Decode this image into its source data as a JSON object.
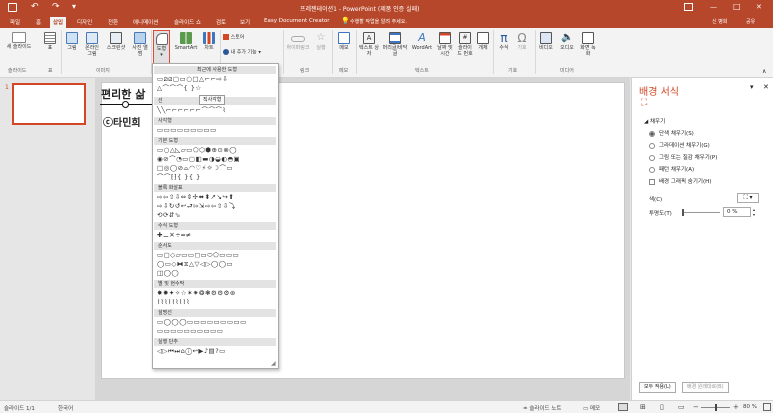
{
  "titlebar": {
    "doc_title": "프레젠테이션1 - PowerPoint (제품 인증 실패)",
    "user": "신 병희",
    "minimize": "—",
    "maximize": "□",
    "close": "✕"
  },
  "tabs": [
    "파일",
    "홈",
    "삽입",
    "디자인",
    "전환",
    "애니메이션",
    "슬라이드 쇼",
    "검토",
    "보기",
    "Easy Document Creator"
  ],
  "active_tab": "삽입",
  "tell_me": "수행할 작업을 알려 주세요.",
  "share": "공유",
  "ribbon": {
    "new_slide": "새 슬라이드",
    "table": "표",
    "picture": "그림",
    "online_picture": "온라인 그림",
    "screenshot": "스크린샷",
    "photo_album": "사진 앨범",
    "shapes": "도형",
    "smartart": "SmartArt",
    "chart": "차트",
    "store": "스토어",
    "my_addins": "내 추가 기능",
    "hyperlink": "하이퍼링크",
    "action": "실행",
    "comment": "메모",
    "textbox": "텍스트 상자",
    "header_footer": "머리글/바닥글",
    "wordart": "WordArt",
    "date_time": "날짜 및 시간",
    "slide_number": "슬라이드 번호",
    "object": "개체",
    "equation": "수식",
    "symbol": "기호",
    "video": "비디오",
    "audio": "오디오",
    "screen_recording": "화면 녹화",
    "groups": {
      "slides": "슬라이드",
      "tables": "표",
      "images": "이미지",
      "links": "링크",
      "comments": "메모",
      "text": "텍스트",
      "symbols": "기호",
      "media": "미디어"
    }
  },
  "gallery": {
    "recent": "최근에 사용한 도형",
    "lines": "선",
    "rectangles": "사각형",
    "basic": "기본 도형",
    "block_arrows": "블록 화살표",
    "equation": "수식 도형",
    "flowchart": "순서도",
    "stars": "별 및 현수막",
    "callouts": "설명선",
    "action_buttons": "실행 단추",
    "tooltip": "직사각형",
    "rows": {
      "recent": "▭⧄⧄▢▭○□△⌐⌐⇨⇩",
      "recent2": "△⌒⌒⌒{ }☆",
      "lines": "╲╲⌐⌐⌐⌐⌐⌐⌒⌒⌒⌇",
      "rectangles": "▭▭▭▭▭▭▭▭▭",
      "basic1": "▭○△◺▱▭⬠⬡⬢⊕⊙⊗◯",
      "basic2": "◉⊘⌒◔▭▢◧▬◑◒◐◓▣",
      "basic3": "□◎◯⊘⌓◠♡⚡☼☽⌒▭",
      "basic4": "⌒⌒⁅⁆{ }{ }",
      "arrows1": "⇨⇦⇧⇩⇔⇕✢⬌⬍↗↘↪⬆",
      "arrows2": "⇨⇩↻↺↩⮐⇰⇲⇨⇦⇧⇩⤵",
      "arrows3": "⟲⟳⇵⬂",
      "eq": "✚⚊✕÷═≠",
      "flow1": "▭▢◇▱▭▭◻▭⬭⬠▭▭▭",
      "flow2": "◯▭◇⧓⧖△▽◁▷◯◯▭",
      "flow3": "◫◯◯",
      "stars1": "✸✹✦✧☆✶✷❂❃⚙⚙⚙⊛",
      "stars2": "⌇⌇⌇⌇⌇⌇⌇⌇⌇",
      "callouts1": "▭◯◯◯▭▭▭▭▭▭▭▭▭",
      "callouts2": "▭▭▭▭▭▭▭▭▭▭",
      "buttons": "◁▷⏮⏭⌂ⓘ↩▶♪▤?▭"
    }
  },
  "slide": {
    "title": "편리한 삶",
    "subtitle": "ⓒ타민희"
  },
  "thumbnail": {
    "number": "1"
  },
  "format_pane": {
    "title": "배경 서식",
    "section": "채우기",
    "options": [
      "단색 채우기(S)",
      "그라데이션 채우기(G)",
      "그림 또는 질감 채우기(P)",
      "패턴 채우기(A)"
    ],
    "selected_option": 0,
    "hide_bg": "배경 그래픽 숨기기(H)",
    "color_label": "색(C)",
    "transparency_label": "투명도(T)",
    "transparency_value": "0 %",
    "apply_all": "모두 적용(L)",
    "reset_bg": "배경 원래대로(B)"
  },
  "status": {
    "slide_count": "슬라이드 1/1",
    "language": "한국어",
    "notes": "슬라이드 노트",
    "comments": "메모",
    "zoom": "80 %"
  },
  "colors": {
    "accent": "#b7472a",
    "ribbon_bg": "#f3f3f3",
    "selected_thumb_border": "#d24726"
  }
}
